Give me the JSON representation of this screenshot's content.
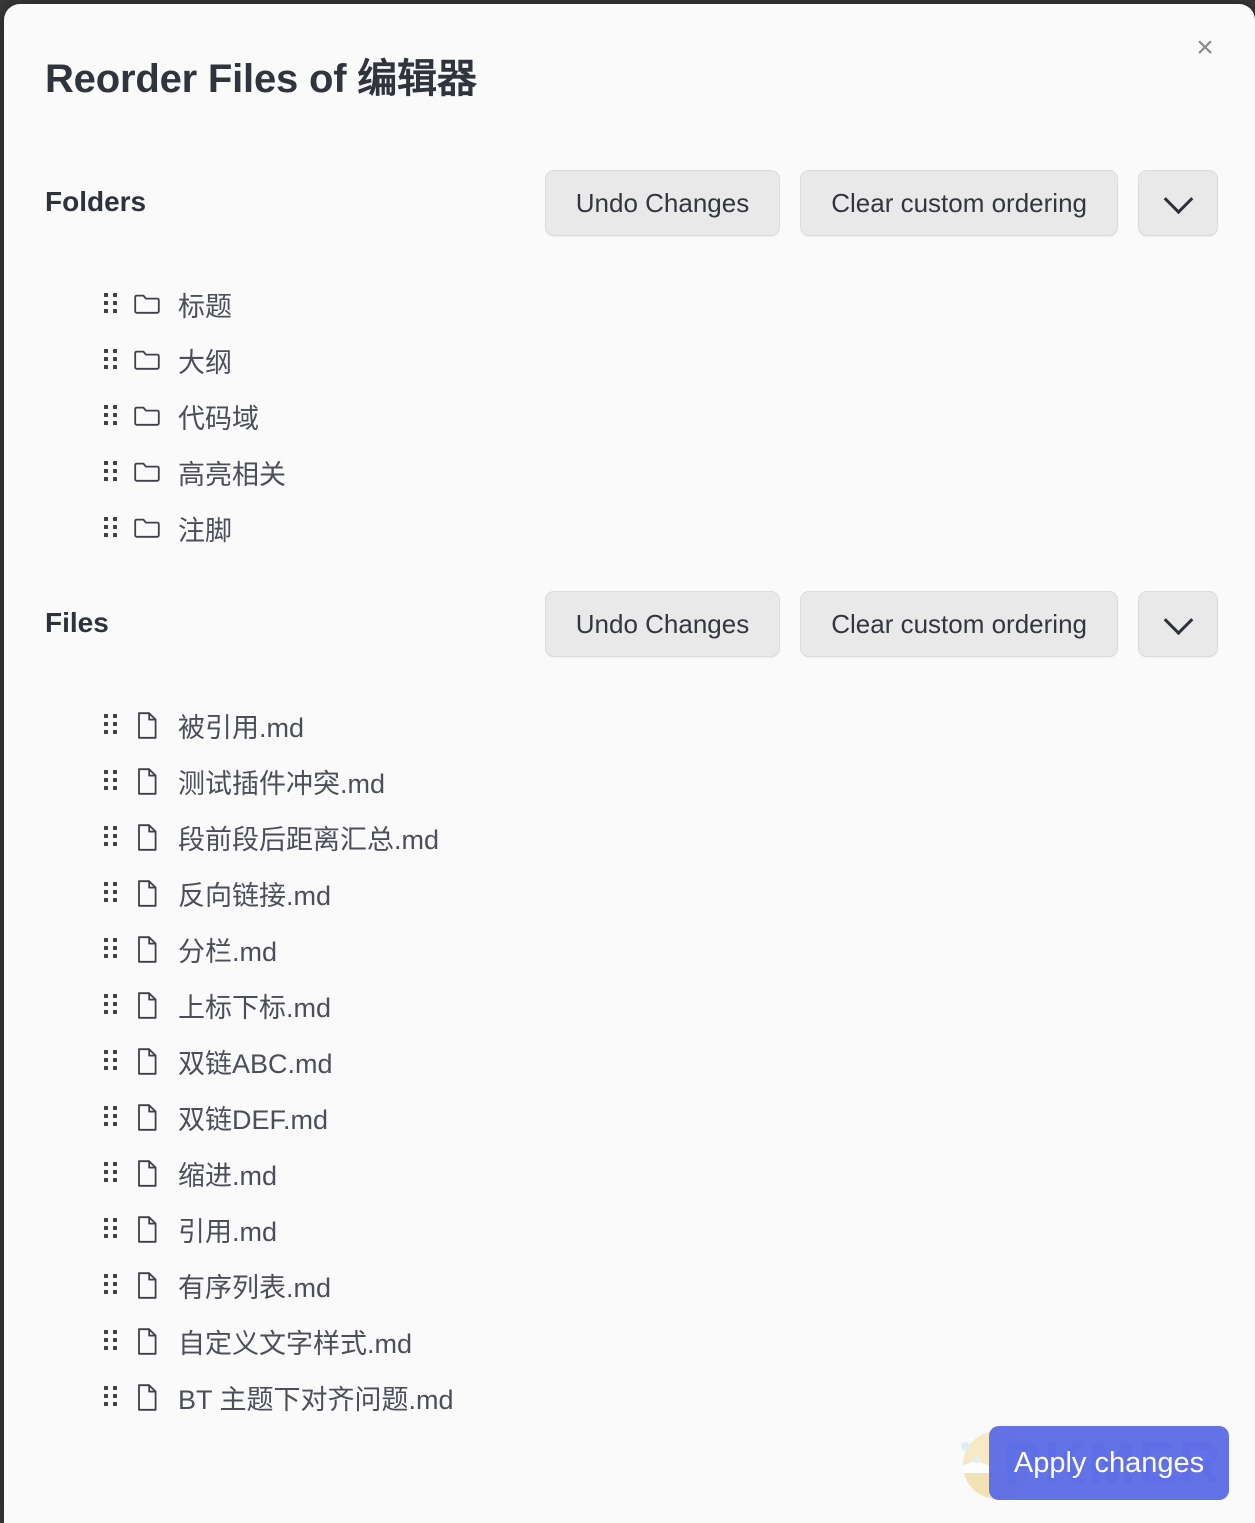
{
  "modal": {
    "title": "Reorder Files of 编辑器",
    "close_label": "×"
  },
  "folders_section": {
    "heading": "Folders",
    "undo_label": "Undo Changes",
    "clear_label": "Clear custom ordering",
    "more_icon": "chevron-down-icon",
    "items": [
      {
        "name": "标题",
        "icon": "folder-icon"
      },
      {
        "name": "大纲",
        "icon": "folder-icon"
      },
      {
        "name": "代码域",
        "icon": "folder-icon"
      },
      {
        "name": "高亮相关",
        "icon": "folder-icon"
      },
      {
        "name": "注脚",
        "icon": "folder-icon"
      }
    ]
  },
  "files_section": {
    "heading": "Files",
    "undo_label": "Undo Changes",
    "clear_label": "Clear custom ordering",
    "more_icon": "chevron-down-icon",
    "items": [
      {
        "name": "被引用.md",
        "icon": "file-icon"
      },
      {
        "name": "测试插件冲突.md",
        "icon": "file-icon"
      },
      {
        "name": "段前段后距离汇总.md",
        "icon": "file-icon"
      },
      {
        "name": "反向链接.md",
        "icon": "file-icon"
      },
      {
        "name": "分栏.md",
        "icon": "file-icon"
      },
      {
        "name": "上标下标.md",
        "icon": "file-icon"
      },
      {
        "name": "双链ABC.md",
        "icon": "file-icon"
      },
      {
        "name": "双链DEF.md",
        "icon": "file-icon"
      },
      {
        "name": "缩进.md",
        "icon": "file-icon"
      },
      {
        "name": "引用.md",
        "icon": "file-icon"
      },
      {
        "name": "有序列表.md",
        "icon": "file-icon"
      },
      {
        "name": "自定义文字样式.md",
        "icon": "file-icon"
      },
      {
        "name": "BT 主题下对齐问题.md",
        "icon": "file-icon"
      }
    ]
  },
  "footer": {
    "apply_label": "Apply changes",
    "watermark_text": "PKMER"
  },
  "colors": {
    "modal_bg": "#fafafa",
    "title_text": "#30353d",
    "item_text": "#4a4f58",
    "button_bg": "#e9e9e9",
    "button_border": "#dcdcdc",
    "apply_bg": "#5968e6",
    "apply_text": "#ffffff"
  }
}
